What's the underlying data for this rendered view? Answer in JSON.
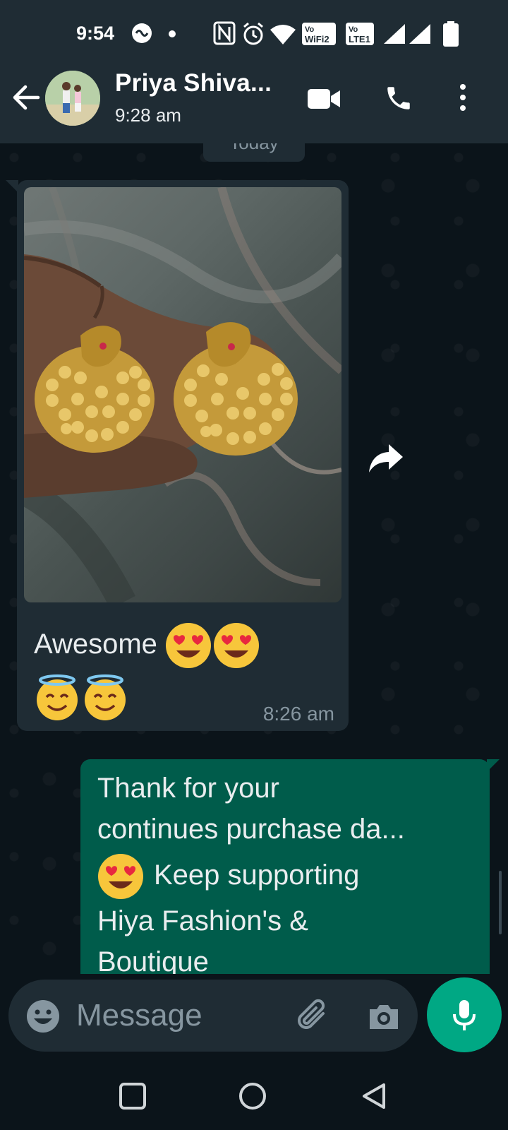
{
  "status_bar": {
    "time": "9:54",
    "wifi_label": "Vo WiFi 2",
    "lte_label": "Vo LTE 1"
  },
  "header": {
    "contact_name": "Priya Shiva...",
    "last_seen": "9:28 am"
  },
  "chat": {
    "date_chip": "Today",
    "messages": [
      {
        "direction": "incoming",
        "type": "image",
        "caption": "Awesome",
        "caption_emojis": [
          "smiling-face-with-heart-eyes",
          "smiling-face-with-heart-eyes",
          "smiling-face-with-halo",
          "smiling-face-with-halo"
        ],
        "time": "8:26 am"
      },
      {
        "direction": "outgoing",
        "type": "text",
        "lines": [
          "Thank for your",
          "continues purchase da...",
          "Keep supporting",
          "Hiya Fashion's &",
          "Boutique"
        ],
        "leading_emoji_line3": "smiling-face-with-heart-eyes"
      }
    ]
  },
  "composer": {
    "placeholder": "Message"
  },
  "colors": {
    "header_bg": "#1f2c34",
    "chat_bg": "#0b141a",
    "incoming_bubble": "#1f2c34",
    "outgoing_bubble": "#005c4b",
    "accent": "#00a884",
    "secondary_text": "#8696a0"
  }
}
